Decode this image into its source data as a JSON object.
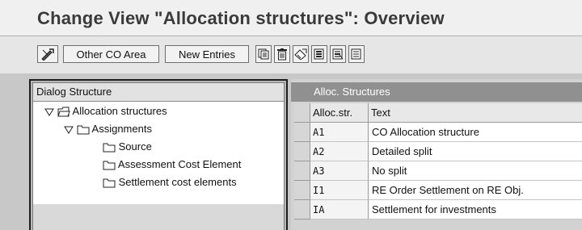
{
  "title": "Change View \"Allocation structures\": Overview",
  "toolbar": {
    "other_co_area": "Other CO Area",
    "new_entries": "New Entries",
    "icons": [
      "display-change-icon",
      "copy-icon",
      "delete-icon",
      "undo-icon",
      "select-all-icon",
      "select-block-icon",
      "deselect-all-icon"
    ]
  },
  "dialog_structure": {
    "header": "Dialog Structure",
    "nodes": [
      {
        "label": "Allocation structures",
        "level": 0,
        "expanded": true,
        "icon": "open-folder-icon"
      },
      {
        "label": "Assignments",
        "level": 1,
        "expanded": true,
        "icon": "folder-icon"
      },
      {
        "label": "Source",
        "level": 2,
        "icon": "folder-icon"
      },
      {
        "label": "Assessment Cost Element",
        "level": 2,
        "icon": "folder-icon"
      },
      {
        "label": "Settlement cost elements",
        "level": 2,
        "icon": "folder-icon"
      }
    ]
  },
  "table": {
    "caption": "Alloc. Structures",
    "columns": [
      "Alloc.str.",
      "Text"
    ],
    "rows": [
      {
        "key": "A1",
        "text": "CO Allocation structure"
      },
      {
        "key": "A2",
        "text": "Detailed split"
      },
      {
        "key": "A3",
        "text": "No split"
      },
      {
        "key": "I1",
        "text": "RE Order Settlement on RE Obj."
      },
      {
        "key": "IA",
        "text": "Settlement for investments"
      }
    ]
  }
}
